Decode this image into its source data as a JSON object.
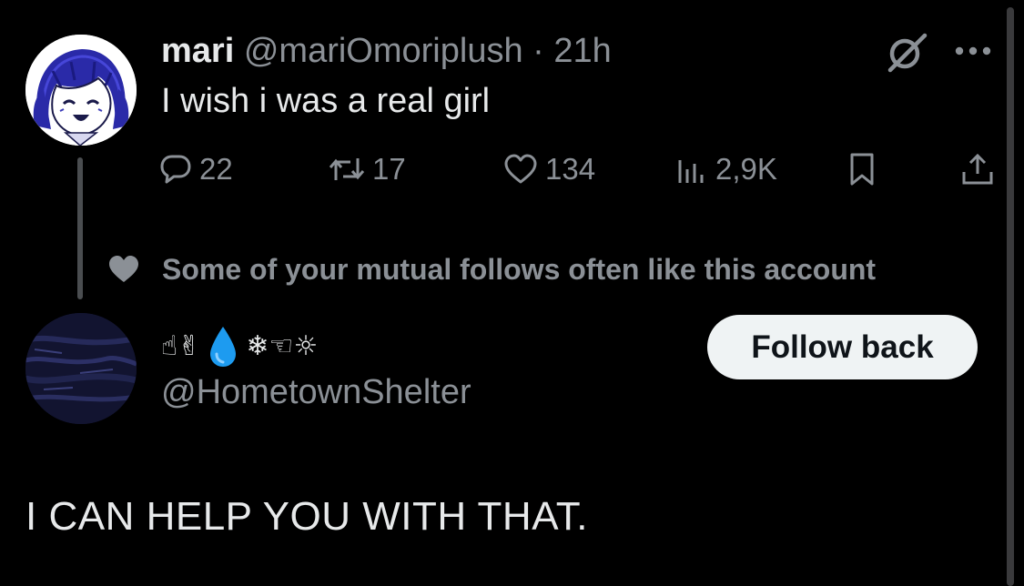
{
  "tweet": {
    "author_name": "mari",
    "author_handle": "@mariOmoriplush",
    "separator": "·",
    "time": "21h",
    "text": "I wish i was a real girl",
    "stats": {
      "replies": "22",
      "reposts": "17",
      "likes": "134",
      "views": "2,9K"
    }
  },
  "social_context": {
    "text": "Some of your mutual follows often like this account"
  },
  "suggested_account": {
    "display_name_emoji": "☝✌",
    "display_name_emoji_2": "❄☜☼",
    "handle": "@HometownShelter",
    "follow_label": "Follow back"
  },
  "reply": {
    "text": "I CAN HELP YOU WITH THAT."
  },
  "icons": {
    "reply": "speech-bubble-icon",
    "repost": "repost-arrows-icon",
    "like": "heart-icon",
    "views": "bar-chart-icon",
    "bookmark": "bookmark-icon",
    "share": "share-upload-icon",
    "grok": "slashed-circle-icon",
    "more": "ellipsis-icon",
    "social": "heart-filled-icon",
    "drop": "water-drop-icon"
  },
  "colors": {
    "background": "#000000",
    "text_primary": "#e7e9ea",
    "text_secondary": "#8b9096",
    "button_bg": "#eff3f4",
    "button_text": "#0f1419",
    "drop_blue": "#1d9bf0"
  }
}
